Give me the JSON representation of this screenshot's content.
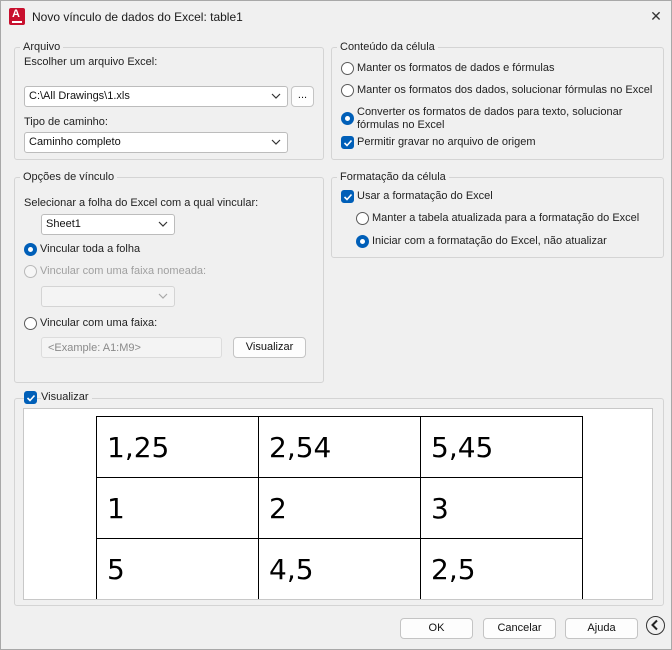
{
  "window": {
    "title": "Novo vínculo de dados do Excel: table1",
    "close_glyph": "✕",
    "app_icon_letter": "A"
  },
  "arquivo": {
    "legend": "Arquivo",
    "choose_label": "Escolher um arquivo Excel:",
    "file_value": "C:\\All Drawings\\1.xls",
    "browse_label": "...",
    "path_type_label": "Tipo de caminho:",
    "path_type_value": "Caminho completo"
  },
  "conteudo": {
    "legend": "Conteúdo da célula",
    "opt1": "Manter os formatos de dados e fórmulas",
    "opt2": "Manter os formatos dos dados, solucionar fórmulas no Excel",
    "opt3_line1": "Converter os formatos de dados para texto, solucionar",
    "opt3_line2": "fórmulas no Excel",
    "selected_option": 3,
    "writeback_label": "Permitir gravar no arquivo de origem",
    "writeback_checked": true
  },
  "opcoes": {
    "legend": "Opções de vínculo",
    "sheet_label": "Selecionar a folha do Excel com a qual vincular:",
    "sheet_value": "Sheet1",
    "link_sheet_label": "Vincular toda a folha",
    "named_range_label": "Vincular com uma faixa nomeada:",
    "range_label": "Vincular com uma faixa:",
    "range_placeholder": "<Example: A1:M9>",
    "preview_button": "Visualizar",
    "selected_option": 1
  },
  "formatacao": {
    "legend": "Formatação da célula",
    "use_excel_label": "Usar a formatação do Excel",
    "use_excel_checked": true,
    "keep_updated_label": "Manter a tabela atualizada para a formatação do Excel",
    "start_excel_label": "Iniciar com a formatação do Excel, não atualizar",
    "selected_option": 2
  },
  "preview": {
    "label": "Visualizar",
    "checked": true,
    "rows": [
      [
        "1,25",
        "2,54",
        "5,45"
      ],
      [
        "1",
        "2",
        "3"
      ],
      [
        "5",
        "4,5",
        "2,5"
      ]
    ]
  },
  "footer": {
    "ok": "OK",
    "cancel": "Cancelar",
    "help": "Ajuda",
    "back_icon": "chevron-left-icon"
  },
  "colors": {
    "accent": "#005fb8",
    "app_icon": "#c8102e",
    "dialog_bg": "#f0f0f0"
  }
}
